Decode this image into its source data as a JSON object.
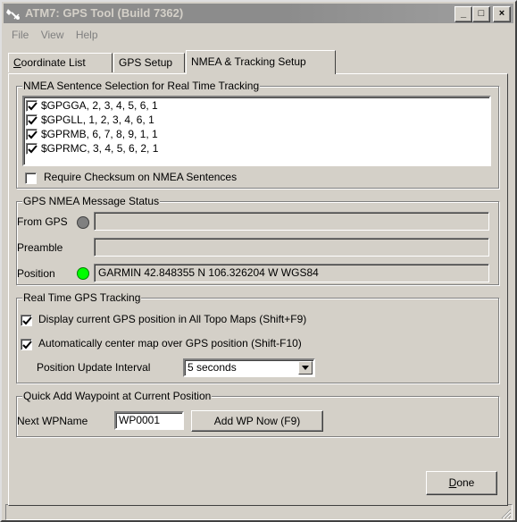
{
  "window": {
    "title": "ATM7: GPS Tool  (Build 7362)",
    "controls": {
      "minimize": "_",
      "maximize": "□",
      "close": "×"
    }
  },
  "menu": [
    {
      "label": "File"
    },
    {
      "label": "View"
    },
    {
      "label": "Help"
    }
  ],
  "tabs": [
    {
      "label": "Coordinate List",
      "mnemonic": "C",
      "rest": "oordinate List"
    },
    {
      "label": "GPS Setup"
    },
    {
      "label": "NMEA & Tracking Setup",
      "active": true
    }
  ],
  "nmea_selection": {
    "title": "NMEA Sentence Selection for Real Time Tracking",
    "sentences": [
      {
        "label": "$GPGGA, 2, 3, 4, 5, 6, 1",
        "checked": true
      },
      {
        "label": "$GPGLL, 1, 2, 3, 4, 6, 1",
        "checked": true
      },
      {
        "label": "$GPRMB, 6, 7, 8, 9, 1, 1",
        "checked": true
      },
      {
        "label": "$GPRMC, 3, 4, 5, 6, 2, 1",
        "checked": true
      }
    ],
    "require_checksum": {
      "label": "Require Checksum on NMEA Sentences",
      "checked": false
    }
  },
  "status": {
    "title": "GPS NMEA Message Status",
    "from_gps_label": "From GPS",
    "from_gps_value": "",
    "from_gps_led": "#808080",
    "preamble_label": "Preamble",
    "preamble_value": "",
    "position_label": "Position",
    "position_value": "GARMIN 42.848355 N 106.326204 W WGS84",
    "position_led": "#00ff00"
  },
  "tracking": {
    "title": "Real Time GPS Tracking",
    "display_current": {
      "label": "Display current GPS position in All Topo Maps (Shift+F9)",
      "checked": true
    },
    "auto_center": {
      "label": "Automatically center map over GPS position (Shift-F10)",
      "checked": true
    },
    "interval_label": "Position Update Interval",
    "interval_value": "5 seconds"
  },
  "waypoint": {
    "title": "Quick Add Waypoint at Current Position",
    "next_label": "Next WPName",
    "next_value": "WP0001",
    "add_button": "Add WP Now (F9)"
  },
  "done_button": {
    "label": "Done",
    "mnemonic": "D",
    "rest": "one"
  },
  "colors": {
    "face": "#d4d0c8",
    "titlebar_inactive": "#8c8c8c",
    "led_green": "#00ff00",
    "led_gray": "#808080"
  }
}
